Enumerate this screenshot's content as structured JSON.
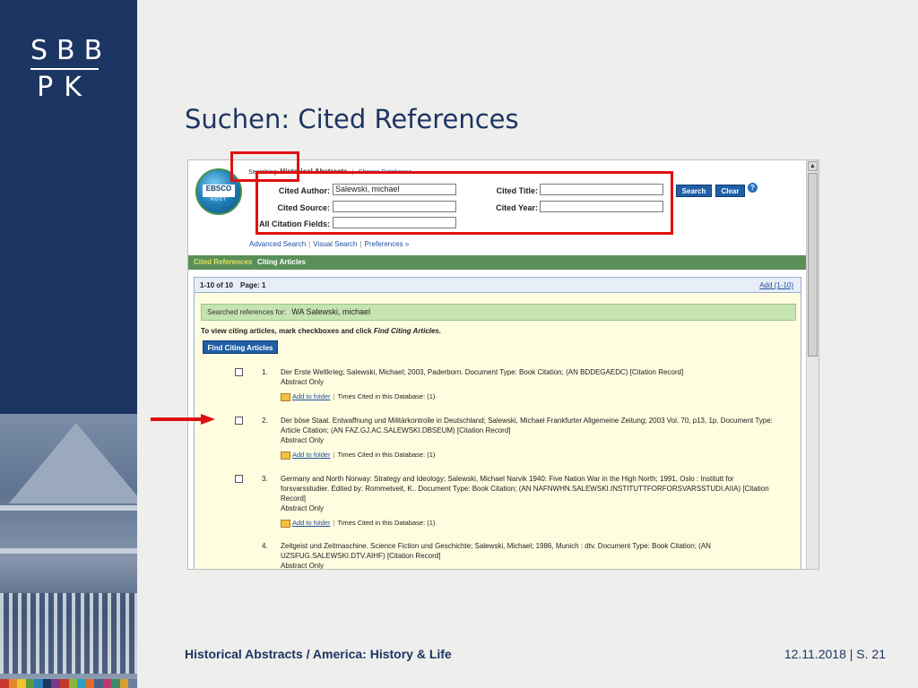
{
  "slide": {
    "title": "Suchen: Cited References",
    "footer_left": "Historical Abstracts / America: History & Life",
    "footer_date": "12.11.2018",
    "footer_sep": "|",
    "footer_page": "S. 21"
  },
  "logo": {
    "line1": "SBB",
    "line2": "PK"
  },
  "ebsco": {
    "logo_text": "EBSCO",
    "host_text": "HOST",
    "searching_label": "Searching:",
    "database": "Historical Abstracts",
    "choose_db": "Choose Databases"
  },
  "search_form": {
    "cited_author_label": "Cited Author:",
    "cited_author_value": "Salewski, michael",
    "cited_source_label": "Cited Source:",
    "cited_source_value": "",
    "all_fields_label": "All Citation Fields:",
    "all_fields_value": "",
    "cited_title_label": "Cited Title:",
    "cited_title_value": "",
    "cited_year_label": "Cited Year:",
    "cited_year_value": "",
    "search_button": "Search",
    "clear_button": "Clear",
    "help": "?"
  },
  "links": {
    "advanced": "Advanced Search",
    "visual": "Visual Search",
    "preferences": "Preferences »"
  },
  "tabs": {
    "cited_refs": "Cited References",
    "citing": "Citing Articles"
  },
  "results": {
    "range": "1-10 of 10",
    "page": "Page: 1",
    "add_all": "Add (1-10)",
    "searched_for_label": "Searched references for:",
    "searched_for_value": "WA Salewski, michael",
    "instruction_prefix": "To view citing articles, mark checkboxes and click",
    "instruction_action": "Find Citing Articles.",
    "find_button": "Find Citing Articles",
    "add_to_folder": "Add to folder",
    "items": [
      {
        "num": "1.",
        "text": "Der Erste Weltkrieg; Salewski, Michael; 2003, Paderborn. Document Type: Book Citation; (AN BDDEGAEDC) [Citation Record]",
        "abstract": "Abstract Only",
        "times_cited": "Times Cited in this Database: (1)"
      },
      {
        "num": "2.",
        "text": "Der böse Staat. Entwaffnung und Militärkontrolle in Deutschland; Salewski, Michael Frankfurter Allgemeine Zeitung; 2003 Vol. 70, p13, 1p. Document Type: Article Citation; (AN FAZ.GJ.AC.SALEWSKI.DBSEUM) [Citation Record]",
        "abstract": "Abstract Only",
        "times_cited": "Times Cited in this Database: (1)"
      },
      {
        "num": "3.",
        "text": "Germany and North Norway: Strategy and Ideology; Salewski, Michael Narvik 1940: Five Nation War in the High North; 1991, Oslo : Institutt for forsvarsstudier. Edited by: Rommetveit, K.. Document Type: Book Citation; (AN NAFNWHN.SALEWSKI.INSTITUTTFORFORSVARSSTUDI.AIIA) [Citation Record]",
        "abstract": "Abstract Only",
        "times_cited": "Times Cited in this Database: (1)"
      },
      {
        "num": "4.",
        "text": "Zeitgeist und Zeitmaschine. Science Fiction und Geschichte; Salewski, Michael; 1986, Munich : dtv. Document Type: Book Citation; (AN UZSFUG.SALEWSKI.DTV.AIHF) [Citation Record]",
        "abstract": "Abstract Only",
        "times_cited": ""
      }
    ]
  },
  "colors": {
    "sidebar": "#1d3563",
    "title": "#1d3563",
    "annotation_red": "#e01010",
    "tab_bar": "#5a8f5a",
    "results_bg": "#fffde0"
  },
  "color_strip": [
    "#c8372d",
    "#e0892a",
    "#f2c230",
    "#5c9a3a",
    "#2b7fb5",
    "#1d3563",
    "#7a3a8a",
    "#c8372d",
    "#8ab43a",
    "#2aa3c0",
    "#e06a2a",
    "#4a5f8a",
    "#b83a6a",
    "#3a8a6a",
    "#d8a02a",
    "#6a7fa0"
  ]
}
